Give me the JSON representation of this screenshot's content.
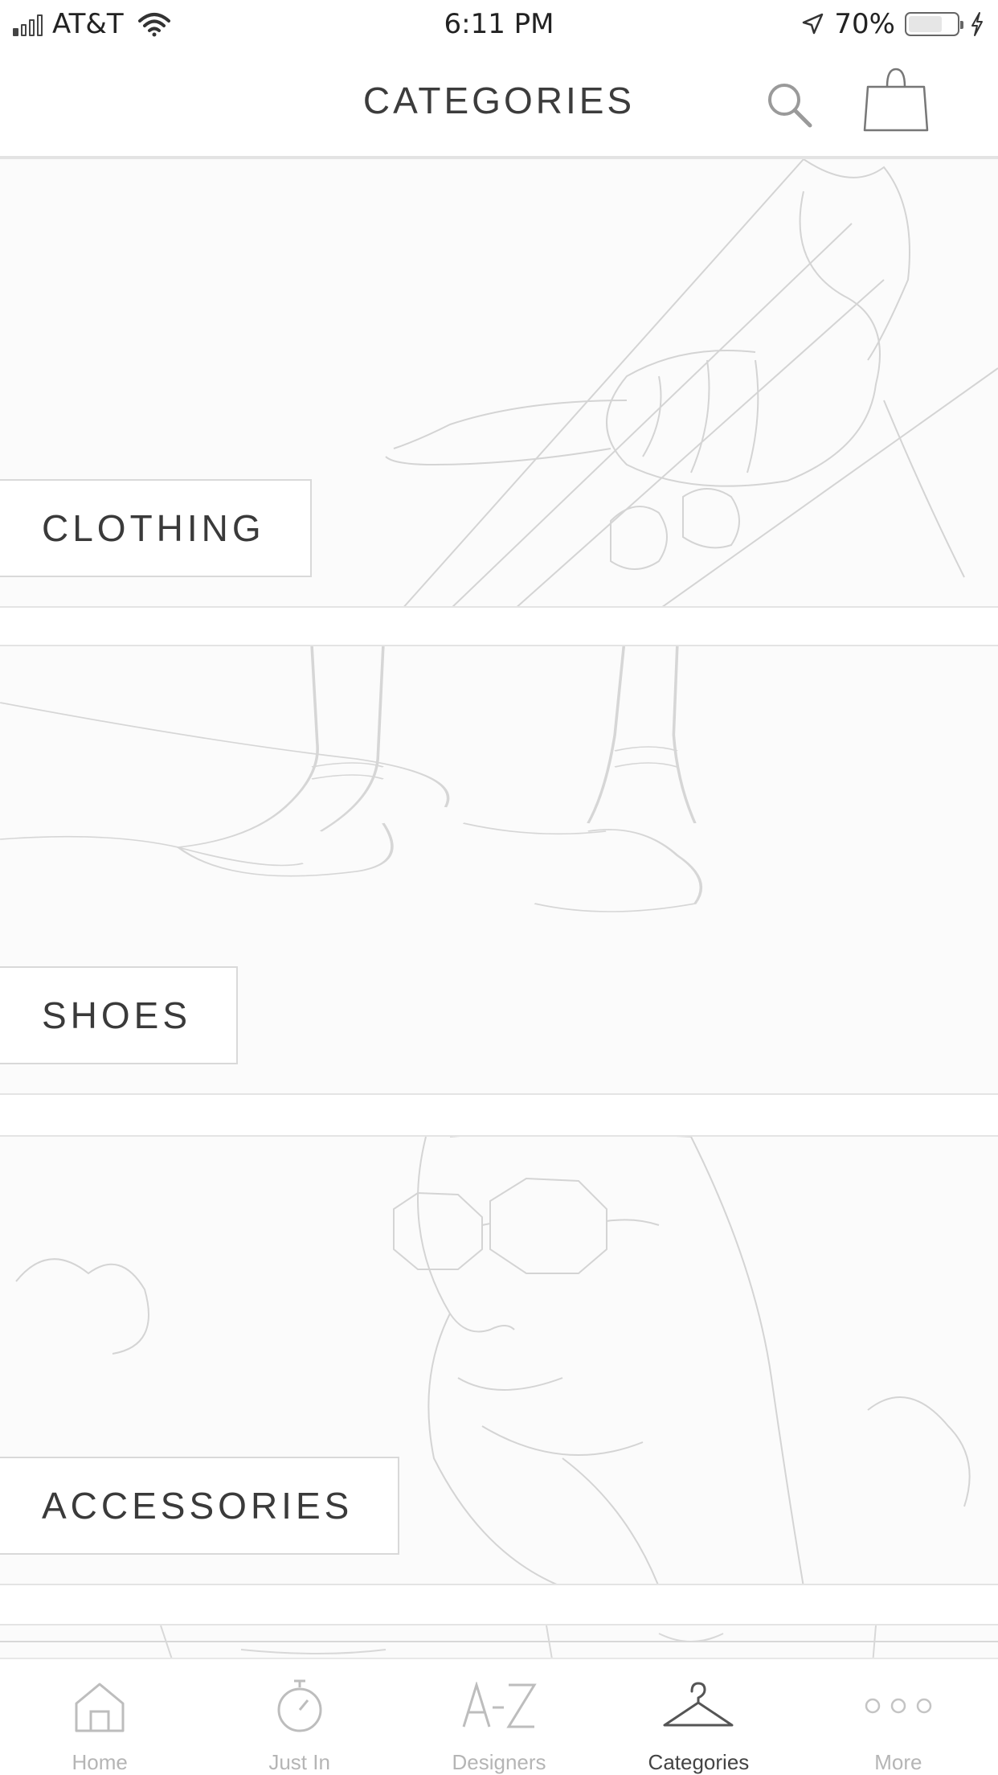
{
  "status_bar": {
    "carrier": "AT&T",
    "time": "6:11 PM",
    "battery_percent": "70%",
    "battery_level": 0.7,
    "signal_bars_on": 1,
    "icons": [
      "signal-icon",
      "wifi-icon",
      "location-arrow-icon",
      "battery-icon",
      "charging-bolt-icon"
    ]
  },
  "header": {
    "title": "CATEGORIES",
    "icons": [
      "search-icon",
      "shopping-bag-icon"
    ]
  },
  "categories": [
    {
      "label": "CLOTHING"
    },
    {
      "label": "SHOES"
    },
    {
      "label": "ACCESSORIES"
    }
  ],
  "tab_bar": {
    "tabs": [
      {
        "label": "Home",
        "icon": "home-icon",
        "active": false
      },
      {
        "label": "Just In",
        "icon": "stopwatch-icon",
        "active": false
      },
      {
        "label": "Designers",
        "icon": "a-z-icon",
        "active": false
      },
      {
        "label": "Categories",
        "icon": "hanger-icon",
        "active": true
      },
      {
        "label": "More",
        "icon": "more-dots-icon",
        "active": false
      }
    ]
  },
  "colors": {
    "text": "#3a3a3a",
    "active_tab": "#444444",
    "inactive_tab": "#b5b5b5",
    "divider": "#e4e4e4"
  }
}
